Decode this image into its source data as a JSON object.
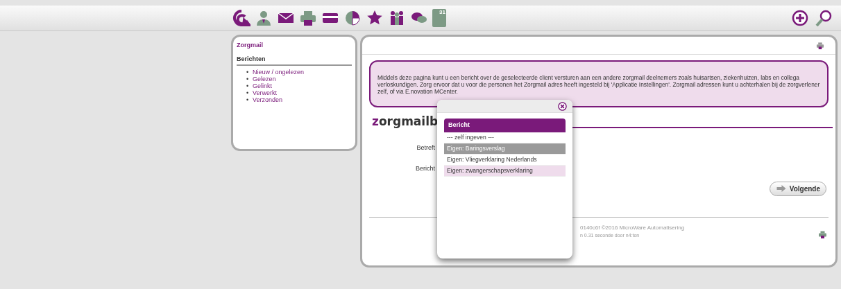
{
  "toolbar": {
    "calendar_day": "31"
  },
  "sidebar": {
    "title": "Zorgmail",
    "section": "Berichten",
    "items": [
      {
        "bullet": "•",
        "label": "Nieuw / ongelezen"
      },
      {
        "bullet": "•",
        "label": "Gelezen"
      },
      {
        "bullet": "•",
        "label": "Gelinkt"
      },
      {
        "bullet": "•",
        "label": "Verwerkt"
      },
      {
        "bullet": "•",
        "label": "Verzonden"
      }
    ]
  },
  "info": "Middels deze pagina kunt u een bericht over de geselecteerde client versturen aan een andere zorgmail deelnemers zoals huisartsen, ziekenhuizen, labs en collega verloskundigen. Zorg ervoor dat u voor die personen het Zorgmail adres heeft ingesteld bij 'Applicatie Instellingen'. Zorgmail adressen kunt u achterhalen bij de zorgverlener zelf, of via E.novation MCenter.",
  "heading": "zorgmailb",
  "form": [
    {
      "label": "Betreft"
    },
    {
      "label": "Bericht"
    }
  ],
  "next_button": "Volgende",
  "footer": [
    "0140c6f ©2016 MicroWare Automatisering",
    "n 0.31 seconde door n4:ton"
  ],
  "popup": {
    "header": "Bericht",
    "options": [
      {
        "label": "--- zelf ingeven ---",
        "selected": false,
        "hovered": false
      },
      {
        "label": "Eigen: Baringsverslag",
        "selected": true,
        "hovered": false
      },
      {
        "label": "Eigen: Vliegverklaring Nederlands",
        "selected": false,
        "hovered": false
      },
      {
        "label": "Eigen: zwangerschapsverklaring",
        "selected": false,
        "hovered": true
      }
    ]
  }
}
